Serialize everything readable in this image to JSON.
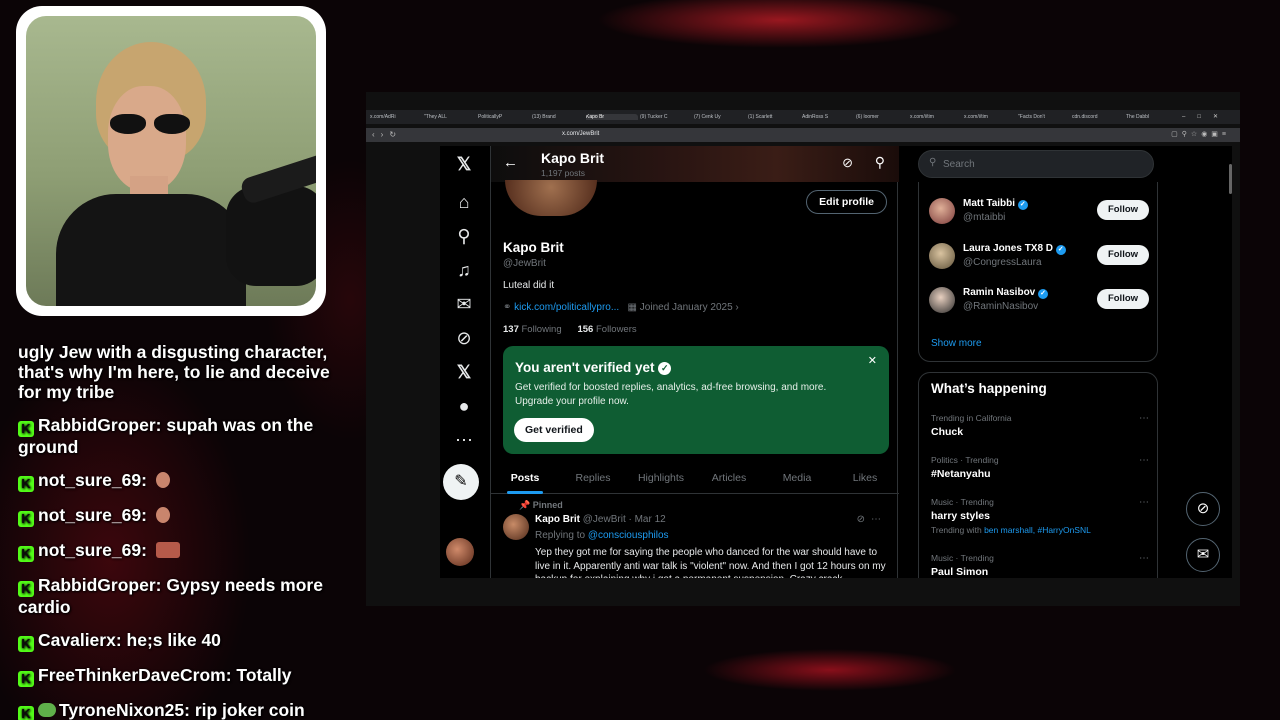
{
  "chat": {
    "lines": [
      {
        "user": "",
        "text": "ugly Jew with a disgusting character, that's why I'm here, to lie and deceive for my tribe"
      },
      {
        "user": "RabbidGroper",
        "text": "supah was on the ground"
      },
      {
        "user": "not_sure_69",
        "text": ""
      },
      {
        "user": "not_sure_69",
        "text": ""
      },
      {
        "user": "not_sure_69",
        "text": ""
      },
      {
        "user": "RabbidGroper",
        "text": "Gypsy needs more cardio"
      },
      {
        "user": "Cavalierx",
        "text": "he;s like 40"
      },
      {
        "user": "FreeThinkerDaveCrom",
        "text": "Totally"
      },
      {
        "user": "TyroneNixon25",
        "text": "rip joker coin"
      }
    ]
  },
  "browser": {
    "tabs": [
      "x.com/AdRi",
      "\"They ALL",
      "PoliticallyP",
      "(13) Brand",
      "Kapo Br",
      "(9) Tucker C",
      "(7) Cenk Uy",
      "(1) Scarlett",
      "AdinRoss S",
      "(6) loomer",
      "x.com/i/tim",
      "x.com/i/tim",
      "\"Facts Don't",
      "cdn.discord",
      "The Dabbl"
    ],
    "url": "x.com/JewBrit"
  },
  "profile": {
    "name": "Kapo Brit",
    "posts_count": "1,197 posts",
    "handle": "@JewBrit",
    "bio": "Luteal did it",
    "link": "kick.com/politicallypro...",
    "joined": "Joined January 2025",
    "following_count": "137",
    "following_label": "Following",
    "followers_count": "156",
    "followers_label": "Followers",
    "edit_label": "Edit profile"
  },
  "verify": {
    "title": "You aren't verified yet",
    "text": "Get verified for boosted replies, analytics, ad-free browsing, and more. Upgrade your profile now.",
    "button": "Get verified"
  },
  "tabs": [
    "Posts",
    "Replies",
    "Highlights",
    "Articles",
    "Media",
    "Likes"
  ],
  "tweet": {
    "pinned": "Pinned",
    "name": "Kapo Brit",
    "handle_date": "@JewBrit · Mar 12",
    "replying_prefix": "Replying to ",
    "replying_to": "@consciousphilos",
    "body": "Yep they got me for saying the people who danced for the war should have to live in it. Apparently anti war talk is \"violent\"  now. And then I got 12 hours on my backup for explaining why i got a permanent suspension. Crazy crack"
  },
  "sidebar": {
    "search_placeholder": "Search",
    "who": [
      {
        "name": "Matt Taibbi",
        "handle": "@mtaibbi",
        "button": "Follow"
      },
      {
        "name": "Laura Jones TX8 D",
        "handle": "@CongressLaura",
        "button": "Follow"
      },
      {
        "name": "Ramin Nasibov",
        "handle": "@RaminNasibov",
        "button": "Follow"
      }
    ],
    "show_more": "Show more",
    "happening_title": "What’s happening",
    "trends": [
      {
        "context": "Trending in California",
        "name": "Chuck",
        "extra_prefix": "",
        "extra": ""
      },
      {
        "context": "Politics · Trending",
        "name": "#Netanyahu",
        "extra_prefix": "",
        "extra": ""
      },
      {
        "context": "Music · Trending",
        "name": "harry styles",
        "extra_prefix": "Trending with ",
        "extra": "ben marshall, #HarryOnSNL"
      },
      {
        "context": "Music · Trending",
        "name": "Paul Simon",
        "extra_prefix": "",
        "extra": ""
      }
    ]
  },
  "colors": {
    "accent": "#1d9bf0",
    "verify_bg": "#0f5d33",
    "kick_green": "#53fc18"
  }
}
